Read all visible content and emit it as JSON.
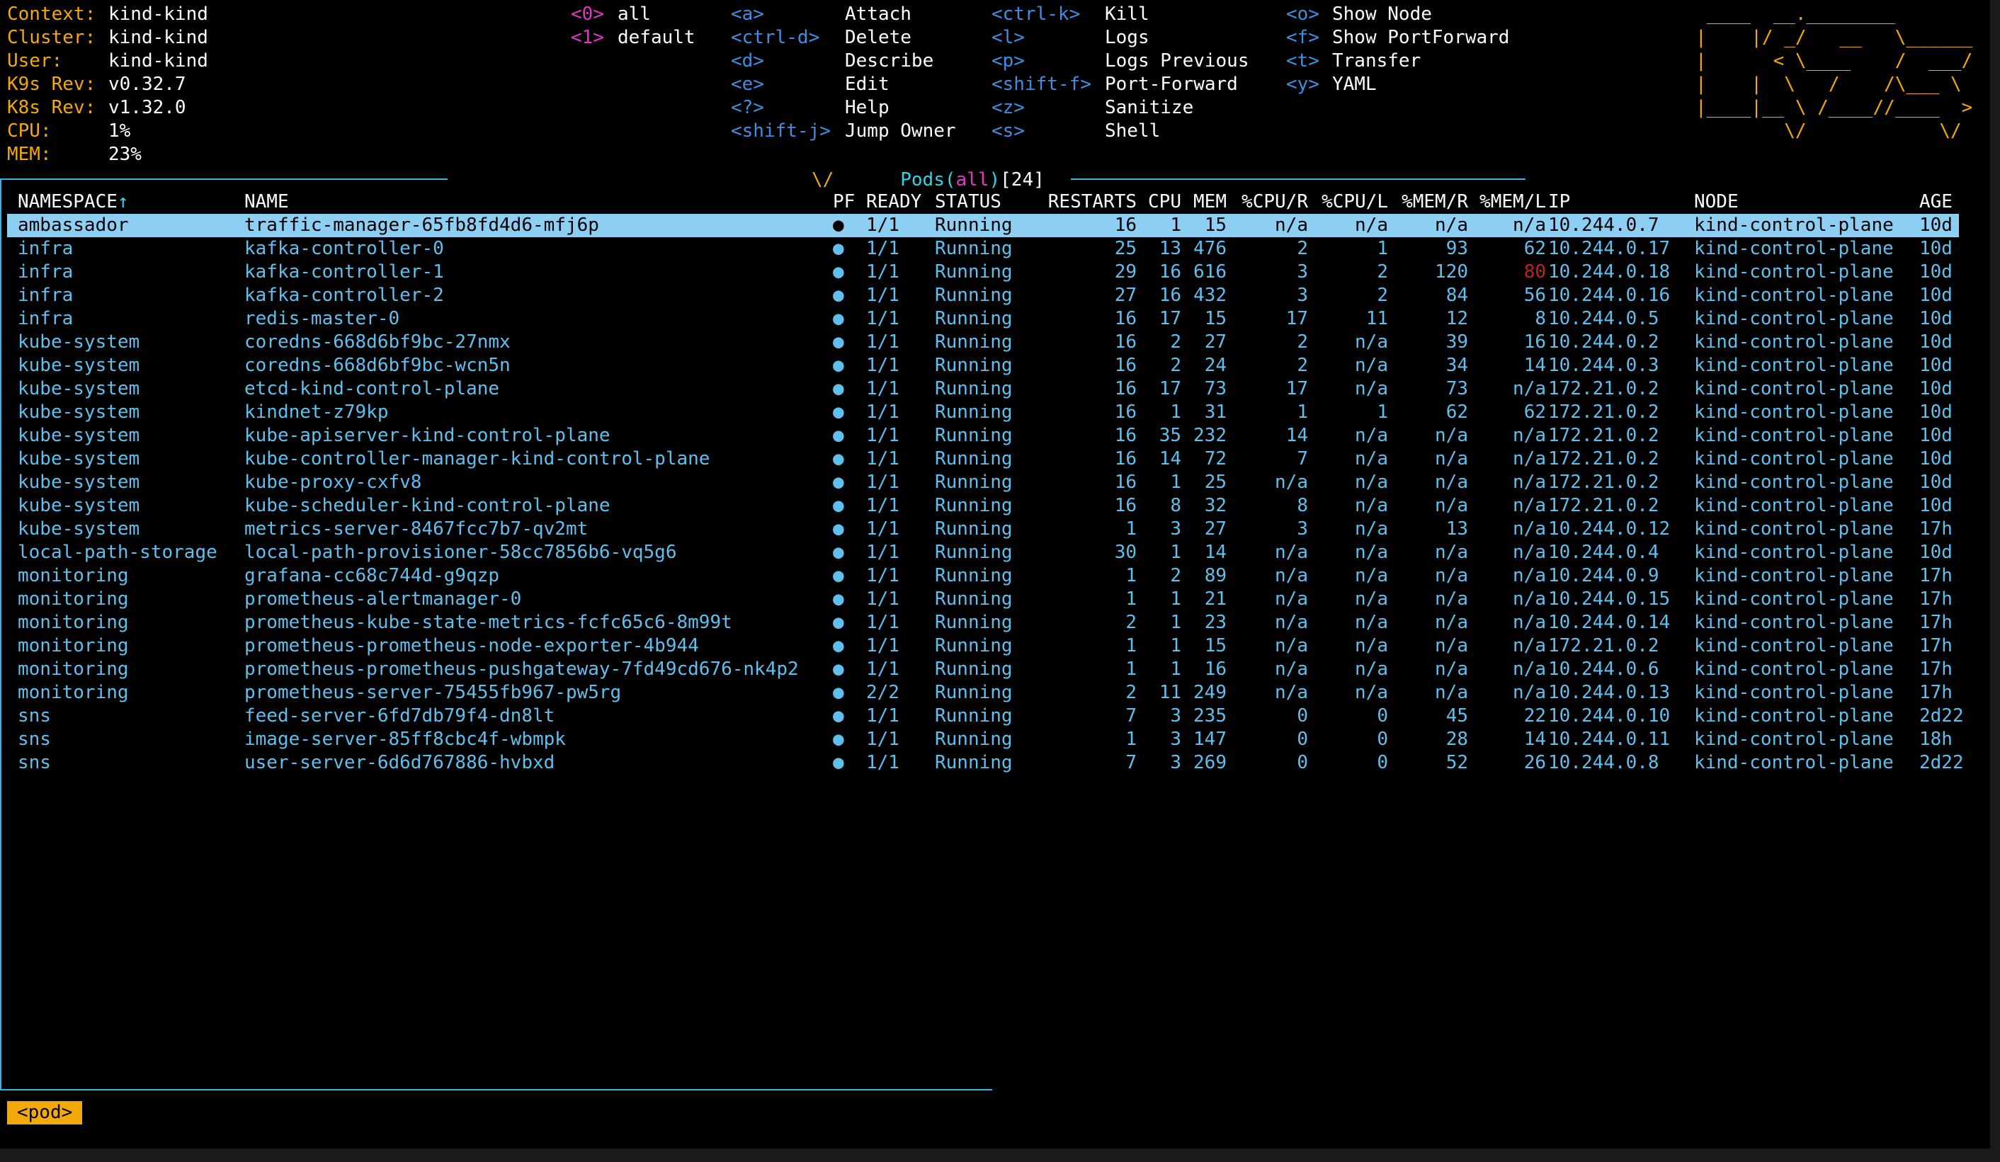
{
  "header": {
    "info": [
      {
        "label": "Context:",
        "value": "kind-kind"
      },
      {
        "label": "Cluster:",
        "value": "kind-kind"
      },
      {
        "label": "User:",
        "value": "kind-kind"
      },
      {
        "label": "K9s Rev:",
        "value": "v0.32.7"
      },
      {
        "label": "K8s Rev:",
        "value": "v1.32.0"
      },
      {
        "label": "CPU:",
        "value": "1%"
      },
      {
        "label": "MEM:",
        "value": "23%"
      }
    ],
    "namespaces": [
      {
        "key": "<0>",
        "name": "all"
      },
      {
        "key": "<1>",
        "name": "default"
      }
    ],
    "hotkeys_col1": [
      {
        "key": "<a>",
        "desc": "Attach"
      },
      {
        "key": "<ctrl-d>",
        "desc": "Delete"
      },
      {
        "key": "<d>",
        "desc": "Describe"
      },
      {
        "key": "<e>",
        "desc": "Edit"
      },
      {
        "key": "<?>",
        "desc": "Help"
      },
      {
        "key": "<shift-j>",
        "desc": "Jump Owner"
      }
    ],
    "hotkeys_col2": [
      {
        "key": "<ctrl-k>",
        "desc": "Kill"
      },
      {
        "key": "<l>",
        "desc": "Logs"
      },
      {
        "key": "<p>",
        "desc": "Logs Previous"
      },
      {
        "key": "<shift-f>",
        "desc": "Port-Forward"
      },
      {
        "key": "<z>",
        "desc": "Sanitize"
      },
      {
        "key": "<s>",
        "desc": "Shell"
      }
    ],
    "hotkeys_col3": [
      {
        "key": "<o>",
        "desc": "Show Node"
      },
      {
        "key": "<f>",
        "desc": "Show PortForward"
      },
      {
        "key": "<t>",
        "desc": "Transfer"
      },
      {
        "key": "<y>",
        "desc": "YAML"
      }
    ],
    "logo": [
      " ____  __.________",
      "|    |/ _/   __   \\______",
      "|      < \\____    /  ___/",
      "|    |  \\   /    /\\___ \\",
      "|____|__ \\ /____//____  >",
      "        \\/            \\/"
    ]
  },
  "view": {
    "chevron": "\\/",
    "resource": "Pods",
    "paren_open": "(",
    "namespace": "all",
    "paren_close": ")",
    "count": "[24]"
  },
  "table": {
    "sort_arrow": "↑",
    "headers": {
      "namespace": "NAMESPACE",
      "name": "NAME",
      "pf": "PF",
      "ready": "READY",
      "status": "STATUS",
      "restarts": "RESTARTS",
      "cpu": "CPU",
      "mem": "MEM",
      "cpu_r": "%CPU/R",
      "cpu_l": "%CPU/L",
      "mem_r": "%MEM/R",
      "mem_l": "%MEM/L",
      "ip": "IP",
      "node": "NODE",
      "age": "AGE"
    },
    "rows": [
      {
        "namespace": "ambassador",
        "name": "traffic-manager-65fb8fd4d6-mfj6p",
        "pf": "●",
        "ready": "1/1",
        "status": "Running",
        "restarts": "16",
        "cpu": "1",
        "mem": "15",
        "cpu_r": "n/a",
        "cpu_l": "n/a",
        "mem_r": "n/a",
        "mem_l": "n/a",
        "ip": "10.244.0.7",
        "node": "kind-control-plane",
        "age": "10d"
      },
      {
        "namespace": "infra",
        "name": "kafka-controller-0",
        "pf": "●",
        "ready": "1/1",
        "status": "Running",
        "restarts": "25",
        "cpu": "13",
        "mem": "476",
        "cpu_r": "2",
        "cpu_l": "1",
        "mem_r": "93",
        "mem_l": "62",
        "ip": "10.244.0.17",
        "node": "kind-control-plane",
        "age": "10d"
      },
      {
        "namespace": "infra",
        "name": "kafka-controller-1",
        "pf": "●",
        "ready": "1/1",
        "status": "Running",
        "restarts": "29",
        "cpu": "16",
        "mem": "616",
        "cpu_r": "3",
        "cpu_l": "2",
        "mem_r": "120",
        "mem_l": "80",
        "ip": "10.244.0.18",
        "node": "kind-control-plane",
        "age": "10d"
      },
      {
        "namespace": "infra",
        "name": "kafka-controller-2",
        "pf": "●",
        "ready": "1/1",
        "status": "Running",
        "restarts": "27",
        "cpu": "16",
        "mem": "432",
        "cpu_r": "3",
        "cpu_l": "2",
        "mem_r": "84",
        "mem_l": "56",
        "ip": "10.244.0.16",
        "node": "kind-control-plane",
        "age": "10d"
      },
      {
        "namespace": "infra",
        "name": "redis-master-0",
        "pf": "●",
        "ready": "1/1",
        "status": "Running",
        "restarts": "16",
        "cpu": "17",
        "mem": "15",
        "cpu_r": "17",
        "cpu_l": "11",
        "mem_r": "12",
        "mem_l": "8",
        "ip": "10.244.0.5",
        "node": "kind-control-plane",
        "age": "10d"
      },
      {
        "namespace": "kube-system",
        "name": "coredns-668d6bf9bc-27nmx",
        "pf": "●",
        "ready": "1/1",
        "status": "Running",
        "restarts": "16",
        "cpu": "2",
        "mem": "27",
        "cpu_r": "2",
        "cpu_l": "n/a",
        "mem_r": "39",
        "mem_l": "16",
        "ip": "10.244.0.2",
        "node": "kind-control-plane",
        "age": "10d"
      },
      {
        "namespace": "kube-system",
        "name": "coredns-668d6bf9bc-wcn5n",
        "pf": "●",
        "ready": "1/1",
        "status": "Running",
        "restarts": "16",
        "cpu": "2",
        "mem": "24",
        "cpu_r": "2",
        "cpu_l": "n/a",
        "mem_r": "34",
        "mem_l": "14",
        "ip": "10.244.0.3",
        "node": "kind-control-plane",
        "age": "10d"
      },
      {
        "namespace": "kube-system",
        "name": "etcd-kind-control-plane",
        "pf": "●",
        "ready": "1/1",
        "status": "Running",
        "restarts": "16",
        "cpu": "17",
        "mem": "73",
        "cpu_r": "17",
        "cpu_l": "n/a",
        "mem_r": "73",
        "mem_l": "n/a",
        "ip": "172.21.0.2",
        "node": "kind-control-plane",
        "age": "10d"
      },
      {
        "namespace": "kube-system",
        "name": "kindnet-z79kp",
        "pf": "●",
        "ready": "1/1",
        "status": "Running",
        "restarts": "16",
        "cpu": "1",
        "mem": "31",
        "cpu_r": "1",
        "cpu_l": "1",
        "mem_r": "62",
        "mem_l": "62",
        "ip": "172.21.0.2",
        "node": "kind-control-plane",
        "age": "10d"
      },
      {
        "namespace": "kube-system",
        "name": "kube-apiserver-kind-control-plane",
        "pf": "●",
        "ready": "1/1",
        "status": "Running",
        "restarts": "16",
        "cpu": "35",
        "mem": "232",
        "cpu_r": "14",
        "cpu_l": "n/a",
        "mem_r": "n/a",
        "mem_l": "n/a",
        "ip": "172.21.0.2",
        "node": "kind-control-plane",
        "age": "10d"
      },
      {
        "namespace": "kube-system",
        "name": "kube-controller-manager-kind-control-plane",
        "pf": "●",
        "ready": "1/1",
        "status": "Running",
        "restarts": "16",
        "cpu": "14",
        "mem": "72",
        "cpu_r": "7",
        "cpu_l": "n/a",
        "mem_r": "n/a",
        "mem_l": "n/a",
        "ip": "172.21.0.2",
        "node": "kind-control-plane",
        "age": "10d"
      },
      {
        "namespace": "kube-system",
        "name": "kube-proxy-cxfv8",
        "pf": "●",
        "ready": "1/1",
        "status": "Running",
        "restarts": "16",
        "cpu": "1",
        "mem": "25",
        "cpu_r": "n/a",
        "cpu_l": "n/a",
        "mem_r": "n/a",
        "mem_l": "n/a",
        "ip": "172.21.0.2",
        "node": "kind-control-plane",
        "age": "10d"
      },
      {
        "namespace": "kube-system",
        "name": "kube-scheduler-kind-control-plane",
        "pf": "●",
        "ready": "1/1",
        "status": "Running",
        "restarts": "16",
        "cpu": "8",
        "mem": "32",
        "cpu_r": "8",
        "cpu_l": "n/a",
        "mem_r": "n/a",
        "mem_l": "n/a",
        "ip": "172.21.0.2",
        "node": "kind-control-plane",
        "age": "10d"
      },
      {
        "namespace": "kube-system",
        "name": "metrics-server-8467fcc7b7-qv2mt",
        "pf": "●",
        "ready": "1/1",
        "status": "Running",
        "restarts": "1",
        "cpu": "3",
        "mem": "27",
        "cpu_r": "3",
        "cpu_l": "n/a",
        "mem_r": "13",
        "mem_l": "n/a",
        "ip": "10.244.0.12",
        "node": "kind-control-plane",
        "age": "17h"
      },
      {
        "namespace": "local-path-storage",
        "name": "local-path-provisioner-58cc7856b6-vq5g6",
        "pf": "●",
        "ready": "1/1",
        "status": "Running",
        "restarts": "30",
        "cpu": "1",
        "mem": "14",
        "cpu_r": "n/a",
        "cpu_l": "n/a",
        "mem_r": "n/a",
        "mem_l": "n/a",
        "ip": "10.244.0.4",
        "node": "kind-control-plane",
        "age": "10d"
      },
      {
        "namespace": "monitoring",
        "name": "grafana-cc68c744d-g9qzp",
        "pf": "●",
        "ready": "1/1",
        "status": "Running",
        "restarts": "1",
        "cpu": "2",
        "mem": "89",
        "cpu_r": "n/a",
        "cpu_l": "n/a",
        "mem_r": "n/a",
        "mem_l": "n/a",
        "ip": "10.244.0.9",
        "node": "kind-control-plane",
        "age": "17h"
      },
      {
        "namespace": "monitoring",
        "name": "prometheus-alertmanager-0",
        "pf": "●",
        "ready": "1/1",
        "status": "Running",
        "restarts": "1",
        "cpu": "1",
        "mem": "21",
        "cpu_r": "n/a",
        "cpu_l": "n/a",
        "mem_r": "n/a",
        "mem_l": "n/a",
        "ip": "10.244.0.15",
        "node": "kind-control-plane",
        "age": "17h"
      },
      {
        "namespace": "monitoring",
        "name": "prometheus-kube-state-metrics-fcfc65c6-8m99t",
        "pf": "●",
        "ready": "1/1",
        "status": "Running",
        "restarts": "2",
        "cpu": "1",
        "mem": "23",
        "cpu_r": "n/a",
        "cpu_l": "n/a",
        "mem_r": "n/a",
        "mem_l": "n/a",
        "ip": "10.244.0.14",
        "node": "kind-control-plane",
        "age": "17h"
      },
      {
        "namespace": "monitoring",
        "name": "prometheus-prometheus-node-exporter-4b944",
        "pf": "●",
        "ready": "1/1",
        "status": "Running",
        "restarts": "1",
        "cpu": "1",
        "mem": "15",
        "cpu_r": "n/a",
        "cpu_l": "n/a",
        "mem_r": "n/a",
        "mem_l": "n/a",
        "ip": "172.21.0.2",
        "node": "kind-control-plane",
        "age": "17h"
      },
      {
        "namespace": "monitoring",
        "name": "prometheus-prometheus-pushgateway-7fd49cd676-nk4p2",
        "pf": "●",
        "ready": "1/1",
        "status": "Running",
        "restarts": "1",
        "cpu": "1",
        "mem": "16",
        "cpu_r": "n/a",
        "cpu_l": "n/a",
        "mem_r": "n/a",
        "mem_l": "n/a",
        "ip": "10.244.0.6",
        "node": "kind-control-plane",
        "age": "17h"
      },
      {
        "namespace": "monitoring",
        "name": "prometheus-server-75455fb967-pw5rg",
        "pf": "●",
        "ready": "2/2",
        "status": "Running",
        "restarts": "2",
        "cpu": "11",
        "mem": "249",
        "cpu_r": "n/a",
        "cpu_l": "n/a",
        "mem_r": "n/a",
        "mem_l": "n/a",
        "ip": "10.244.0.13",
        "node": "kind-control-plane",
        "age": "17h"
      },
      {
        "namespace": "sns",
        "name": "feed-server-6fd7db79f4-dn8lt",
        "pf": "●",
        "ready": "1/1",
        "status": "Running",
        "restarts": "7",
        "cpu": "3",
        "mem": "235",
        "cpu_r": "0",
        "cpu_l": "0",
        "mem_r": "45",
        "mem_l": "22",
        "ip": "10.244.0.10",
        "node": "kind-control-plane",
        "age": "2d22"
      },
      {
        "namespace": "sns",
        "name": "image-server-85ff8cbc4f-wbmpk",
        "pf": "●",
        "ready": "1/1",
        "status": "Running",
        "restarts": "1",
        "cpu": "3",
        "mem": "147",
        "cpu_r": "0",
        "cpu_l": "0",
        "mem_r": "28",
        "mem_l": "14",
        "ip": "10.244.0.11",
        "node": "kind-control-plane",
        "age": "18h"
      },
      {
        "namespace": "sns",
        "name": "user-server-6d6d767886-hvbxd",
        "pf": "●",
        "ready": "1/1",
        "status": "Running",
        "restarts": "7",
        "cpu": "3",
        "mem": "269",
        "cpu_r": "0",
        "cpu_l": "0",
        "mem_r": "52",
        "mem_l": "26",
        "ip": "10.244.0.8",
        "node": "kind-control-plane",
        "age": "2d22"
      }
    ]
  },
  "breadcrumb": "<pod>",
  "colors": {
    "label": "#f2a90a",
    "hotkey": "#3f8ee4",
    "row": "#5fc0ee",
    "selected_bg": "#8ccff3",
    "border": "#2fb6e8",
    "warning": "#c22020"
  }
}
